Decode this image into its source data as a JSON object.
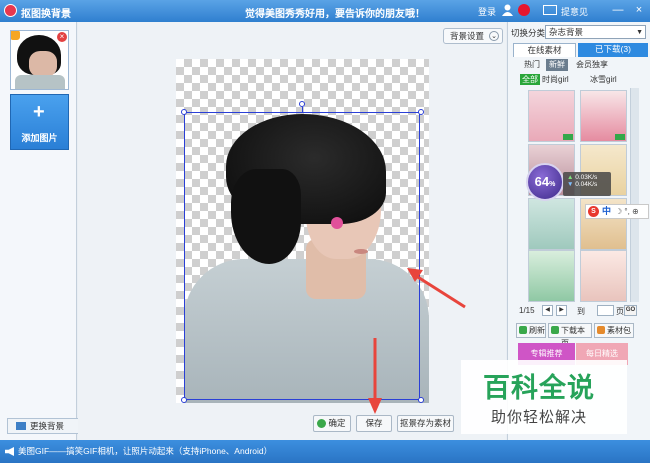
{
  "titlebar": {
    "app_title": "抠图换背景",
    "slogan": "觉得美图秀秀好用，要告诉你的朋友哦！",
    "login": "登录",
    "feedback": "提意见",
    "min": "—",
    "max": "□",
    "close": "×"
  },
  "left_panel": {
    "add_photo_plus": "+",
    "add_photo_label": "添加图片",
    "change_bg_label": "更换背景",
    "thumb_delete": "×"
  },
  "canvas": {
    "bg_settings_label": "背景设置",
    "bg_settings_chevron": "⌄",
    "confirm_label": "确定",
    "save_label": "保存",
    "save_as_label": "抠景存为素材"
  },
  "right_panel": {
    "switch_label": "切换分类",
    "category_value": "杂志背景",
    "category_arrow": "▼",
    "tabs": [
      {
        "label": "在线素材"
      },
      {
        "label": "已下载(3)"
      }
    ],
    "subtabs": [
      {
        "label": "热门"
      },
      {
        "label": "新鲜"
      },
      {
        "label": "会员独享"
      }
    ],
    "filters": [
      {
        "label": "全部"
      },
      {
        "label": "时尚girl"
      },
      {
        "label": "冰雪girl"
      }
    ],
    "pager": {
      "page": "1/15",
      "to_label": "到",
      "page_unit": "页",
      "go": "GO",
      "prev": "◀",
      "next": "▶"
    },
    "tools": [
      {
        "label": "刷新"
      },
      {
        "label": "下载本页"
      },
      {
        "label": "素材包"
      }
    ],
    "promos": [
      {
        "label": "专辑推荐"
      },
      {
        "label": "每日精选"
      }
    ]
  },
  "overlays": {
    "speed_value": "64",
    "speed_unit": "%",
    "upload_rate": "0.03K/s",
    "download_rate": "0.04K/s",
    "ime_s": "S",
    "ime_zh": "中",
    "ime_rest": "☽ °, ⊕"
  },
  "watermark": {
    "line1": "百科全说",
    "line2": "助你轻松解决"
  },
  "statusbar": {
    "text": "美图GIF——搞笑GIF相机，让照片动起来（支持iPhone、Android）"
  },
  "colors": {
    "accent": "#2e8ae0",
    "selection": "#2a3fd6",
    "arrow": "#e8453c",
    "watermark": "#27a35a"
  }
}
